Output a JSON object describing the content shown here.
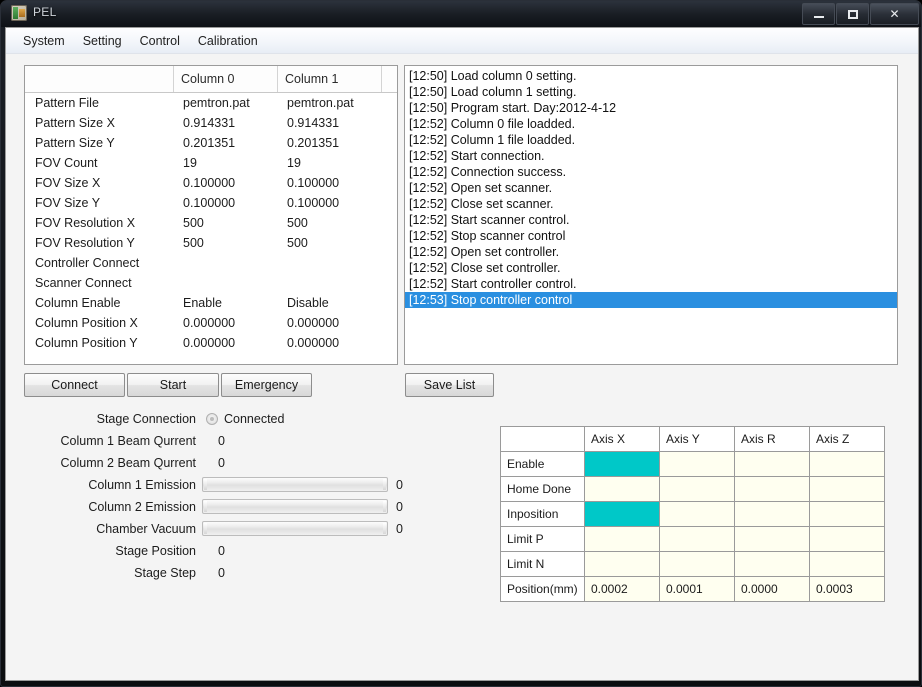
{
  "window": {
    "title": "PEL",
    "app_icon": "application-icon",
    "minimize_label": "Minimize",
    "maximize_label": "Maximize",
    "close_label": "Close"
  },
  "menu": {
    "items": [
      {
        "label": "System"
      },
      {
        "label": "Setting"
      },
      {
        "label": "Control"
      },
      {
        "label": "Calibration"
      }
    ]
  },
  "column_table": {
    "headers": [
      "",
      "Column 0",
      "Column 1",
      ""
    ],
    "rows": [
      {
        "label": "Pattern File",
        "col0": "pemtron.pat",
        "col1": "pemtron.pat"
      },
      {
        "label": "Pattern Size X",
        "col0": "0.914331",
        "col1": "0.914331"
      },
      {
        "label": "Pattern Size Y",
        "col0": "0.201351",
        "col1": "0.201351"
      },
      {
        "label": "FOV Count",
        "col0": "19",
        "col1": "19"
      },
      {
        "label": "FOV Size X",
        "col0": "0.100000",
        "col1": "0.100000"
      },
      {
        "label": "FOV Size Y",
        "col0": "0.100000",
        "col1": "0.100000"
      },
      {
        "label": "FOV Resolution X",
        "col0": "500",
        "col1": "500"
      },
      {
        "label": "FOV Resolution Y",
        "col0": "500",
        "col1": "500"
      },
      {
        "label": "Controller Connect",
        "col0": "",
        "col1": ""
      },
      {
        "label": "Scanner Connect",
        "col0": "",
        "col1": ""
      },
      {
        "label": "Column Enable",
        "col0": "Enable",
        "col1": "Disable"
      },
      {
        "label": "Column Position X",
        "col0": "0.000000",
        "col1": "0.000000"
      },
      {
        "label": "Column Position Y",
        "col0": "0.000000",
        "col1": "0.000000"
      }
    ]
  },
  "log": {
    "selection_color": "#2a8fe0",
    "lines": [
      {
        "text": "[12:50] Load column 0 setting.",
        "selected": false
      },
      {
        "text": "[12:50] Load column 1 setting.",
        "selected": false
      },
      {
        "text": "[12:50] Program start. Day:2012-4-12",
        "selected": false
      },
      {
        "text": "[12:52] Column 0 file loadded.",
        "selected": false
      },
      {
        "text": "[12:52] Column 1 file loadded.",
        "selected": false
      },
      {
        "text": "[12:52] Start connection.",
        "selected": false
      },
      {
        "text": "[12:52] Connection success.",
        "selected": false
      },
      {
        "text": "[12:52] Open set scanner.",
        "selected": false
      },
      {
        "text": "[12:52] Close set scanner.",
        "selected": false
      },
      {
        "text": "[12:52] Start scanner control.",
        "selected": false
      },
      {
        "text": "[12:52] Stop scanner control",
        "selected": false
      },
      {
        "text": "[12:52] Open set controller.",
        "selected": false
      },
      {
        "text": "[12:52] Close set controller.",
        "selected": false
      },
      {
        "text": "[12:52] Start controller control.",
        "selected": false
      },
      {
        "text": "[12:53] Stop controller control",
        "selected": true
      }
    ]
  },
  "buttons": {
    "connect": "Connect",
    "start": "Start",
    "emergency": "Emergency",
    "save_list": "Save List"
  },
  "status": {
    "stage_connection_label": "Stage Connection",
    "stage_connection_value": "Connected",
    "stage_connection_indicator": "radio-indicator-off",
    "rows": [
      {
        "label": "Column 1 Beam Qurrent",
        "value": "0",
        "type": "text"
      },
      {
        "label": "Column 2 Beam Qurrent",
        "value": "0",
        "type": "text"
      },
      {
        "label": "Column 1 Emission",
        "value": "0",
        "type": "bar"
      },
      {
        "label": "Column 2 Emission",
        "value": "0",
        "type": "bar"
      },
      {
        "label": "Chamber Vacuum",
        "value": "0",
        "type": "bar"
      },
      {
        "label": "Stage Position",
        "value": "0",
        "type": "text"
      },
      {
        "label": "Stage Step",
        "value": "0",
        "type": "text"
      }
    ]
  },
  "axis_table": {
    "on_color": "#00c8c8",
    "cell_color": "#fffff0",
    "columns": [
      "",
      "Axis X",
      "Axis Y",
      "Axis R",
      "Axis Z"
    ],
    "rows": [
      {
        "label": "Enable",
        "cells": [
          "on",
          "",
          "",
          ""
        ]
      },
      {
        "label": "Home Done",
        "cells": [
          "",
          "",
          "",
          ""
        ]
      },
      {
        "label": "Inposition",
        "cells": [
          "on",
          "",
          "",
          ""
        ]
      },
      {
        "label": "Limit P",
        "cells": [
          "",
          "",
          "",
          ""
        ]
      },
      {
        "label": "Limit N",
        "cells": [
          "",
          "",
          "",
          ""
        ]
      },
      {
        "label": "Position(mm)",
        "cells": [
          "0.0002",
          "0.0001",
          "0.0000",
          "0.0003"
        ]
      }
    ]
  }
}
